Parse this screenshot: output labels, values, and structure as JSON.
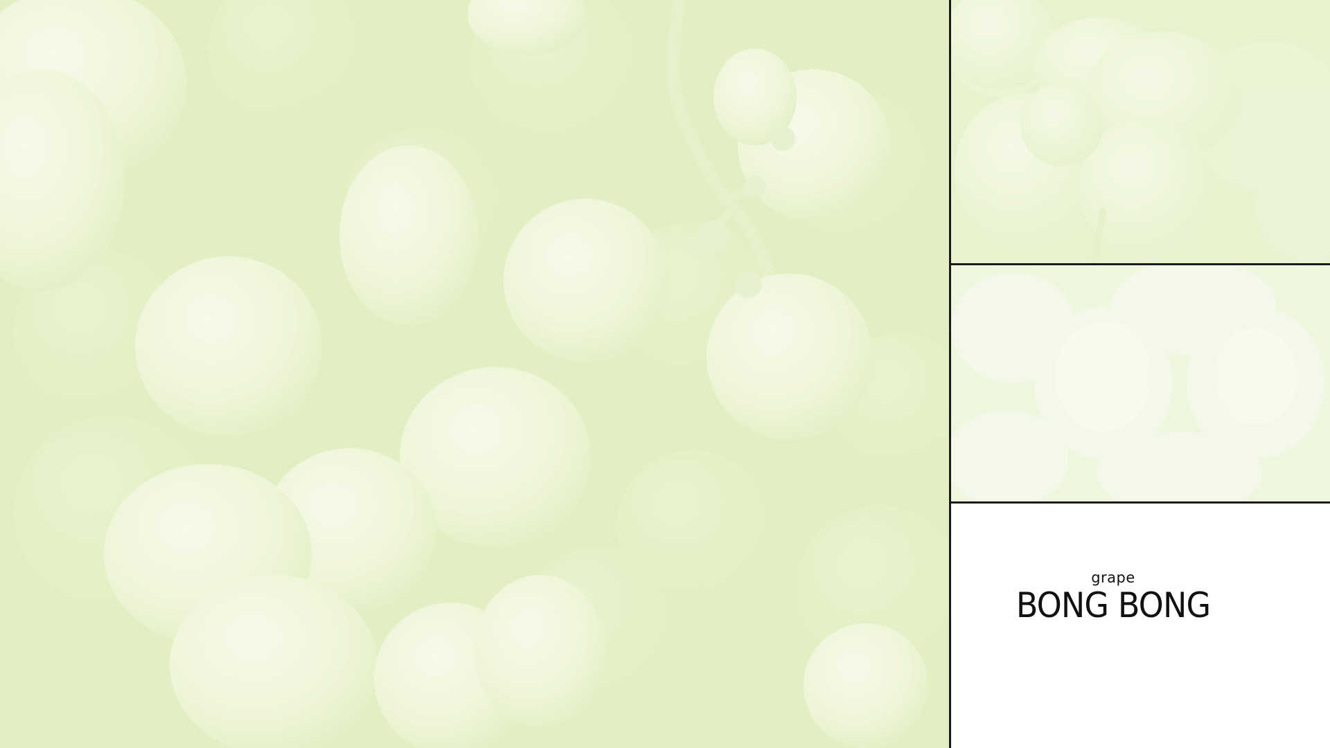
{
  "branding": {
    "subtitle": "grape",
    "title": "BONG BONG"
  },
  "photos": {
    "main": "green-grapes-closeup-photo",
    "top_right": "green-grapes-detail-photo",
    "middle_right": "green-grapes-soft-focus-photo"
  },
  "colors": {
    "background_tint": "#e3efc2",
    "grape_light": "#f3f8e4",
    "divider": "#1a1a1a",
    "text": "#111111"
  }
}
